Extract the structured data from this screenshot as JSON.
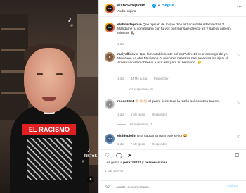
{
  "video": {
    "banner_text": "EL RACISMO",
    "tiktok_handle_top": "@",
    "tiktok_word": "TikTok",
    "tiktok_handle_bottom": "@",
    "mute_icon": "speaker-muted-icon"
  },
  "header": {
    "username": "elshowdepiolin",
    "follow_label": "Seguir",
    "separator": "•",
    "audio_label": "Audio original",
    "more_label": "..."
  },
  "comments": [
    {
      "username": "elshowdepiolin",
      "text": "Que opinan de lo que dice el Sacerdote Adam Kotas ? Mándame tu comentario con tu voz por mensaje directo Ya Y sale al aire en minutos 🙏🏽",
      "time": "1 día"
    },
    {
      "username": "maiyelli4ever",
      "text": "Que lamentablemente así es Piolin. El peor enemigo de yn Mexicano es otro Mexicano. Y mientras nosotros nos sacamos los ojos, el Americano solo observa y usa eso para su beneficio. 😔",
      "time": "1 día",
      "likes": "44 Me gusta",
      "reply": "Responder",
      "replies": "Ver respuestas (8)"
    },
    {
      "username": "rosae8224",
      "text": "👏🏻👏🏻👏🏻 el padre tiene toda la razón así conozco barios .",
      "time": "1 día",
      "likes": "5 Me gusta",
      "reply": "Responder",
      "replies": "Ver respuestas (1)"
    },
    {
      "username": "eldjdepiolin",
      "text": "Una caguama para este señor 🤩",
      "time": "1 día",
      "likes": "7 Me gusta",
      "reply": "Responder"
    }
  ],
  "actions": {
    "like_icon": "heart-icon",
    "comment_icon": "comment-icon",
    "share_icon": "send-icon",
    "save_icon": "bookmark-icon"
  },
  "likes": {
    "prefix": "Les gusta a",
    "user": "perezz8233",
    "suffix": "y",
    "others": "personas más"
  },
  "date": "1 DE JUNIO",
  "add_comment": {
    "placeholder": "Añadir un comentario...",
    "publish_label": "Publicar"
  }
}
